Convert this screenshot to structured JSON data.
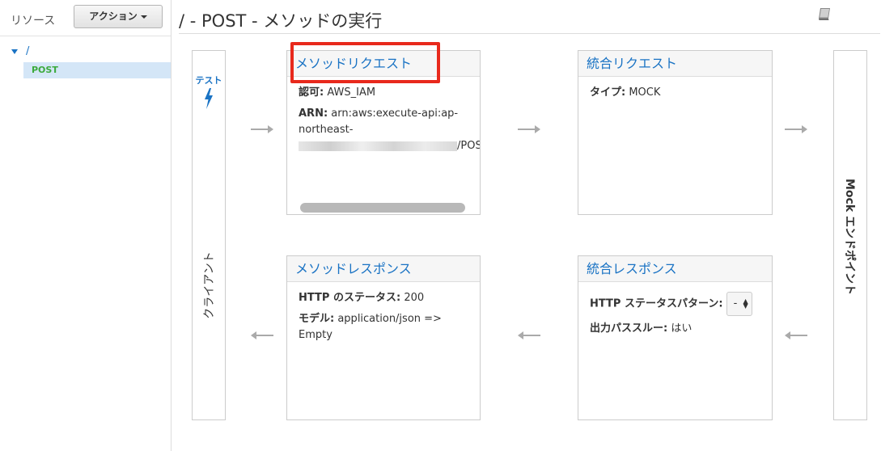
{
  "sidebar": {
    "title": "リソース",
    "action_button": "アクション",
    "tree": {
      "root": "/",
      "method": "POST"
    }
  },
  "main": {
    "title": "/ - POST - メソッドの実行",
    "client": {
      "test_label": "テスト",
      "label": "クライアント"
    },
    "endpoint": {
      "label": "Mock エンドポイント"
    },
    "method_request": {
      "title": "メソッドリクエスト",
      "auth_label": "認可:",
      "auth_value": "AWS_IAM",
      "arn_label": "ARN:",
      "arn_line1": "arn:aws:execute-api:ap-",
      "arn_line2": "northeast-",
      "arn_line3_suffix": "/POS"
    },
    "integration_request": {
      "title": "統合リクエスト",
      "type_label": "タイプ:",
      "type_value": "MOCK"
    },
    "method_response": {
      "title": "メソッドレスポンス",
      "status_label": "HTTP のステータス:",
      "status_value": "200",
      "model_label": "モデル:",
      "model_value": "application/json => Empty"
    },
    "integration_response": {
      "title": "統合レスポンス",
      "pattern_label": "HTTP ステータスパターン:",
      "pattern_value": "-",
      "passthrough_label": "出力パススルー:",
      "passthrough_value": "はい"
    }
  },
  "colors": {
    "link_blue": "#1a73c4",
    "post_green": "#3caa3c",
    "highlight_red": "#e8291c",
    "arrow_gray": "#aaaaaa"
  },
  "icons": {
    "book": "book-icon",
    "bolt": "lightning-icon"
  }
}
